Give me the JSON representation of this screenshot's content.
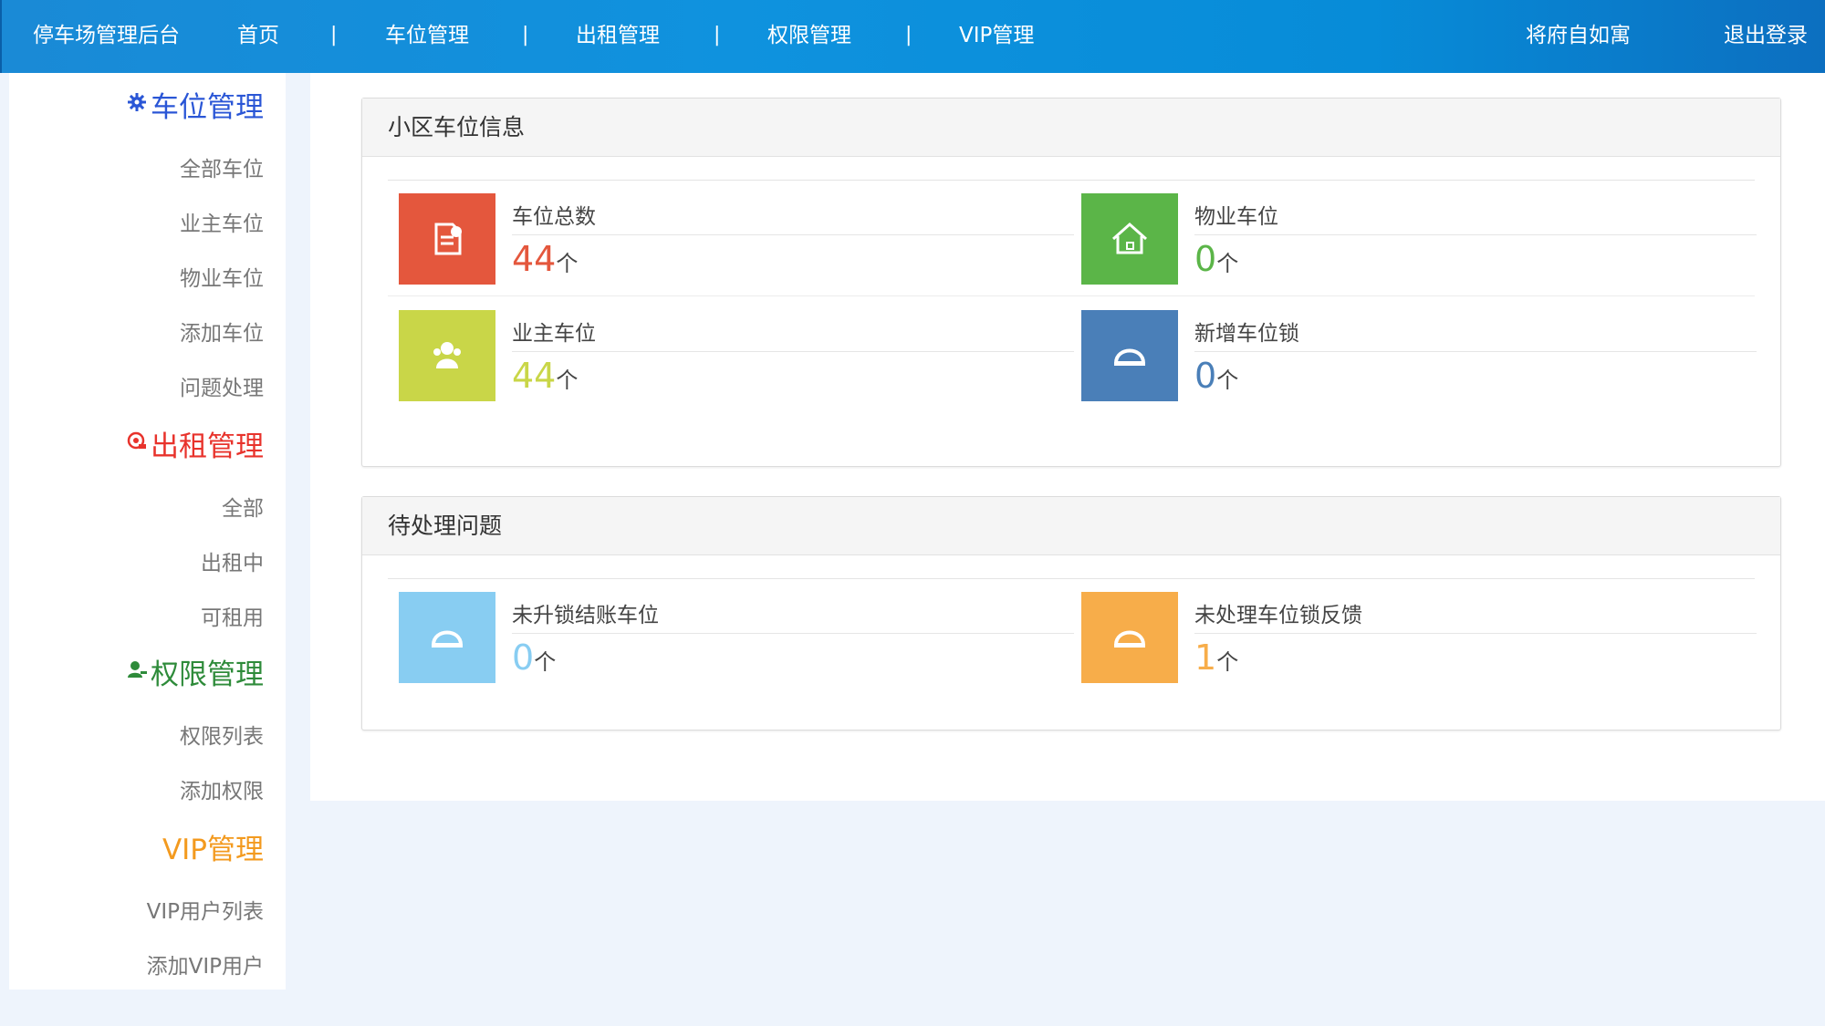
{
  "header": {
    "app_title": "停车场管理后台",
    "nav": [
      "首页",
      "车位管理",
      "出租管理",
      "权限管理",
      "VIP管理"
    ],
    "separator": "|",
    "user_name": "将府自如寓",
    "logout": "退出登录"
  },
  "sidebar": {
    "groups": [
      {
        "title": "车位管理",
        "icon": "gear-icon",
        "color": "#2a56d6",
        "items": [
          "全部车位",
          "业主车位",
          "物业车位",
          "添加车位",
          "问题处理"
        ]
      },
      {
        "title": "出租管理",
        "icon": "camera-icon",
        "color": "#e8332c",
        "items": [
          "全部",
          "出租中",
          "可租用"
        ]
      },
      {
        "title": "权限管理",
        "icon": "user-icon",
        "color": "#2e8b3a",
        "items": [
          "权限列表",
          "添加权限"
        ]
      },
      {
        "title": "VIP管理",
        "icon": "",
        "color": "#f39a1f",
        "items": [
          "VIP用户列表",
          "添加VIP用户"
        ]
      }
    ]
  },
  "panels": {
    "info": {
      "title": "小区车位信息",
      "stats": [
        {
          "label": "车位总数",
          "value": "44",
          "unit": "个",
          "color": "#e4573d",
          "icon": "document-icon"
        },
        {
          "label": "物业车位",
          "value": "0",
          "unit": "个",
          "color": "#5bb548",
          "icon": "house-icon"
        },
        {
          "label": "业主车位",
          "value": "44",
          "unit": "个",
          "color": "#c9d648",
          "icon": "group-icon"
        },
        {
          "label": "新增车位锁",
          "value": "0",
          "unit": "个",
          "color": "#4a7fb8",
          "icon": "lock-icon"
        }
      ]
    },
    "pending": {
      "title": "待处理问题",
      "stats": [
        {
          "label": "未升锁结账车位",
          "value": "0",
          "unit": "个",
          "color": "#88cdf2",
          "icon": "lock-icon"
        },
        {
          "label": "未处理车位锁反馈",
          "value": "1",
          "unit": "个",
          "color": "#f7ad4a",
          "icon": "lock-icon"
        }
      ]
    }
  }
}
